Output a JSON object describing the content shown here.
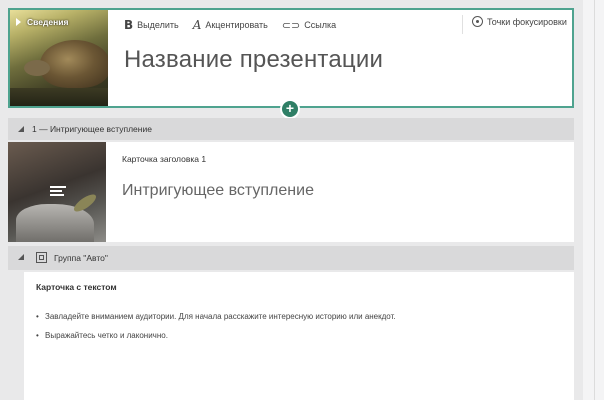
{
  "title_card": {
    "section_label": "Сведения",
    "title": "Название презентации",
    "toolbar": {
      "bold_label": "Выделить",
      "italic_label": "Акцентировать",
      "link_label": "Ссылка",
      "focus_label": "Точки фокусировки",
      "bold_glyph": "B",
      "italic_glyph": "A",
      "link_glyph": "⊂⊃"
    },
    "add_glyph": "+"
  },
  "section1": {
    "label": "1 — Интригующее вступление",
    "card": {
      "label": "Карточка заголовка 1",
      "title": "Интригующее вступление"
    }
  },
  "section2": {
    "label": "Группа \"Авто\"",
    "card": {
      "label": "Карточка с текстом",
      "bullets": [
        "Завладейте вниманием аудитории. Для начала расскажите интересную историю или анекдот.",
        "Выражайтесь четко и лаконично."
      ]
    }
  },
  "colors": {
    "accent": "#4fa38f",
    "add_button": "#2f7f66",
    "section_bar": "#d9d9da",
    "background": "#e9e9ea"
  }
}
